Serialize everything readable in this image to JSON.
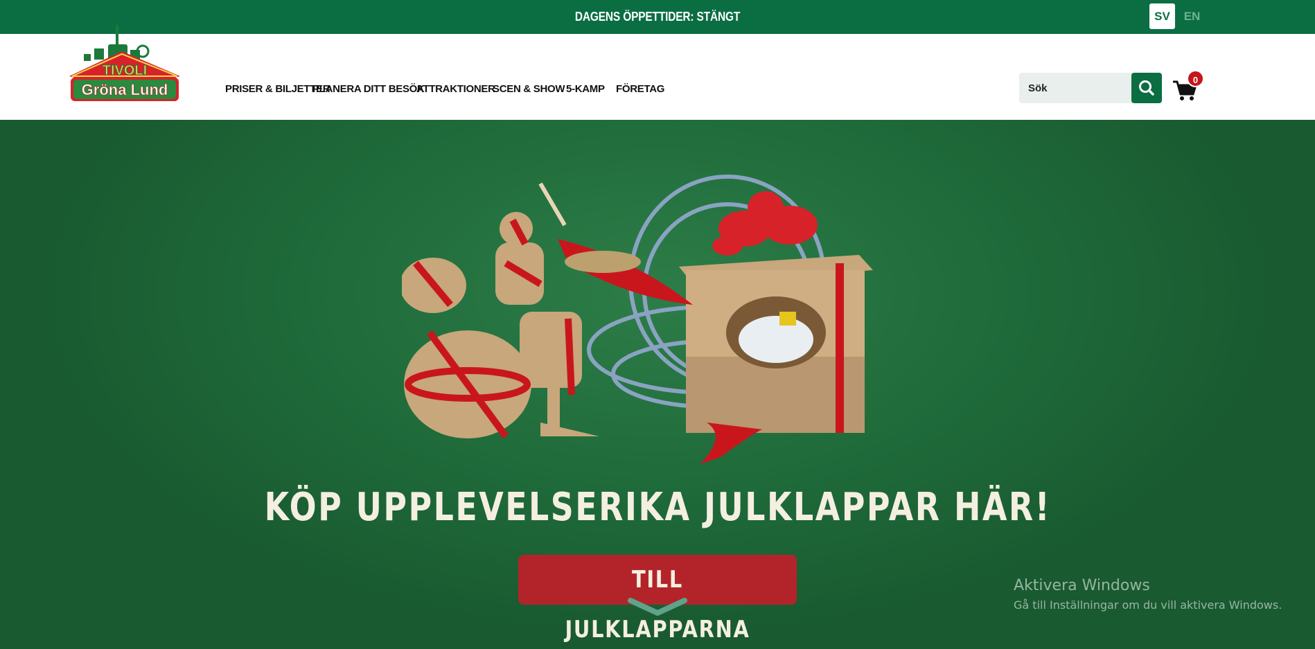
{
  "topbar": {
    "hours_text": "DAGENS ÖPPETTIDER: STÄNGT",
    "languages": [
      {
        "label": "SV",
        "active": true
      },
      {
        "label": "EN",
        "active": false
      }
    ]
  },
  "header": {
    "logo": {
      "line1": "TIVOLI",
      "line2": "Gröna Lund"
    },
    "nav": [
      "PRISER & BILJETTER",
      "PLANERA DITT BESÖK",
      "ATTRAKTIONER",
      "SCEN & SHOW",
      "5-KAMP",
      "FÖRETAG"
    ],
    "search_placeholder": "Sök",
    "search_icon": "search-icon",
    "cart_icon": "cart-icon",
    "cart_count": "0"
  },
  "hero": {
    "headline": "KÖP UPPLEVELSERIKA JULKLAPPAR HÄR!",
    "cta_label": "TILL JULKLAPPARNA",
    "scroll_icon": "chevron-down-icon"
  },
  "watermark": {
    "title": "Aktivera Windows",
    "subtitle": "Gå till Inställningar om du vill aktivera Windows."
  },
  "colors": {
    "brand_green": "#0b6e43",
    "hero_green": "#1f6b3a",
    "cta_red": "#b3242a",
    "badge_red": "#c4161c",
    "headline_cream": "#f4efe1"
  }
}
